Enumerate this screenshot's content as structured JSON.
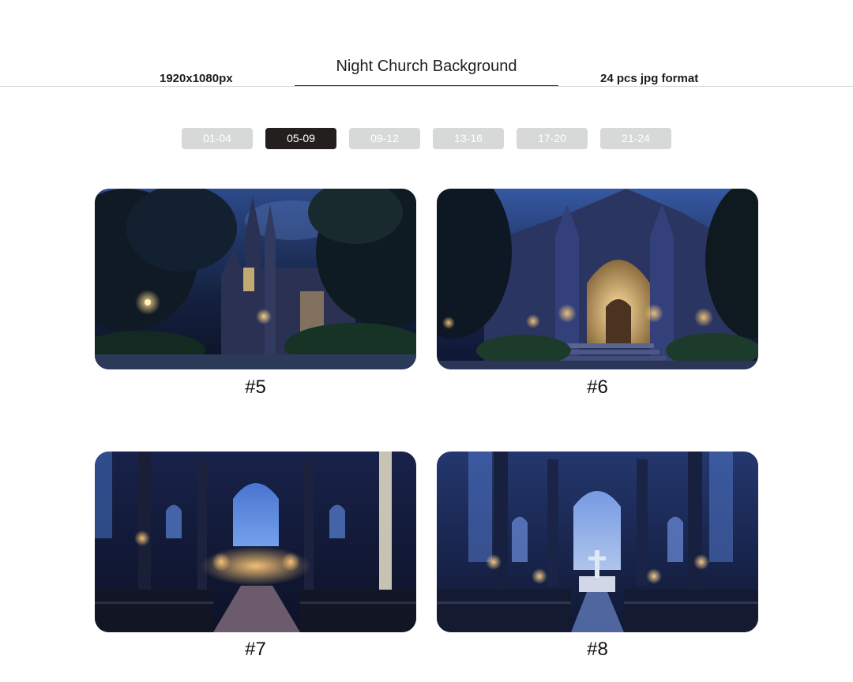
{
  "header": {
    "title": "Night Church Background",
    "resolution": "1920x1080px",
    "format": "24 pcs jpg format"
  },
  "tabs": [
    {
      "label": "01-04",
      "active": false
    },
    {
      "label": "05-09",
      "active": true
    },
    {
      "label": "09-12",
      "active": false
    },
    {
      "label": "13-16",
      "active": false
    },
    {
      "label": "17-20",
      "active": false
    },
    {
      "label": "21-24",
      "active": false
    }
  ],
  "gallery": [
    {
      "caption": "#5",
      "scene": "church-exterior-trees-night"
    },
    {
      "caption": "#6",
      "scene": "church-entrance-stairs-night"
    },
    {
      "caption": "#7",
      "scene": "church-interior-candles-stained-glass"
    },
    {
      "caption": "#8",
      "scene": "church-interior-altar-cross"
    }
  ],
  "colors": {
    "tab_inactive": "#d7d9d9",
    "tab_active": "#241f1f",
    "night_blue": "#1b2a55",
    "warm_light": "#ffc870"
  }
}
